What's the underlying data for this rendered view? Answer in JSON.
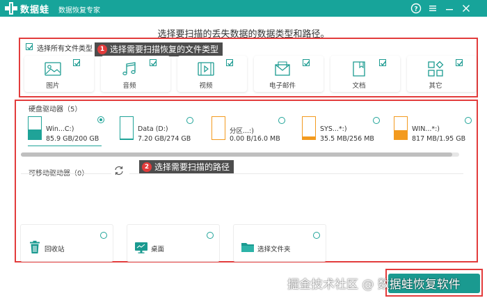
{
  "app": {
    "logo_text": "数据蛙",
    "subtitle": "数据恢复专家"
  },
  "headline": "选择要扫描的丢失数据的数据类型和路径。",
  "file_types": {
    "select_all_label": "选择所有文件类型",
    "items": [
      {
        "label": "图片",
        "icon": "image-icon",
        "checked": true
      },
      {
        "label": "音频",
        "icon": "audio-icon",
        "checked": true
      },
      {
        "label": "视频",
        "icon": "video-icon",
        "checked": true
      },
      {
        "label": "电子邮件",
        "icon": "email-icon",
        "checked": true
      },
      {
        "label": "文档",
        "icon": "document-icon",
        "checked": true
      },
      {
        "label": "其它",
        "icon": "other-icon",
        "checked": true
      }
    ]
  },
  "tips": {
    "tip1_number": "1",
    "tip1_text": "选择需要扫描恢复的文件类型",
    "tip2_number": "2",
    "tip2_text": "选择需要扫描的路径"
  },
  "hard_drives": {
    "title": "硬盘驱动器（5）",
    "items": [
      {
        "name": "Win...C:)",
        "size": "85.9 GB/200 GB",
        "fill": 0.43,
        "fill_color": "#1fa398",
        "selected": true
      },
      {
        "name": "Data (D:)",
        "size": "7.20 GB/274 GB",
        "fill": 0.03,
        "fill_color": "#1fa398",
        "selected": false
      },
      {
        "name": "分区...:)",
        "size": "0.00  B/16.0 MB",
        "fill": 0.0,
        "fill_color": "#f39a1e",
        "selected": false
      },
      {
        "name": "SYS...*:)",
        "size": "35.5 MB/256 MB",
        "fill": 0.14,
        "fill_color": "#f39a1e",
        "selected": false
      },
      {
        "name": "WIN...*:)",
        "size": "817 MB/1.95 GB",
        "fill": 0.42,
        "fill_color": "#f39a1e",
        "selected": false
      }
    ]
  },
  "removable": {
    "title": "可移动驱动器（0）",
    "refresh_icon": "refresh-icon"
  },
  "locations": [
    {
      "label": "回收站",
      "icon": "recycle-bin-icon"
    },
    {
      "label": "桌面",
      "icon": "desktop-icon"
    },
    {
      "label": "选择文件夹",
      "icon": "folder-icon"
    }
  ],
  "watermark": "掘金技术社区 @ 数据蛙恢复软件",
  "colors": {
    "accent": "#17a49a",
    "annotation_red": "#e23b3b",
    "drive_orange": "#f39a1e"
  }
}
